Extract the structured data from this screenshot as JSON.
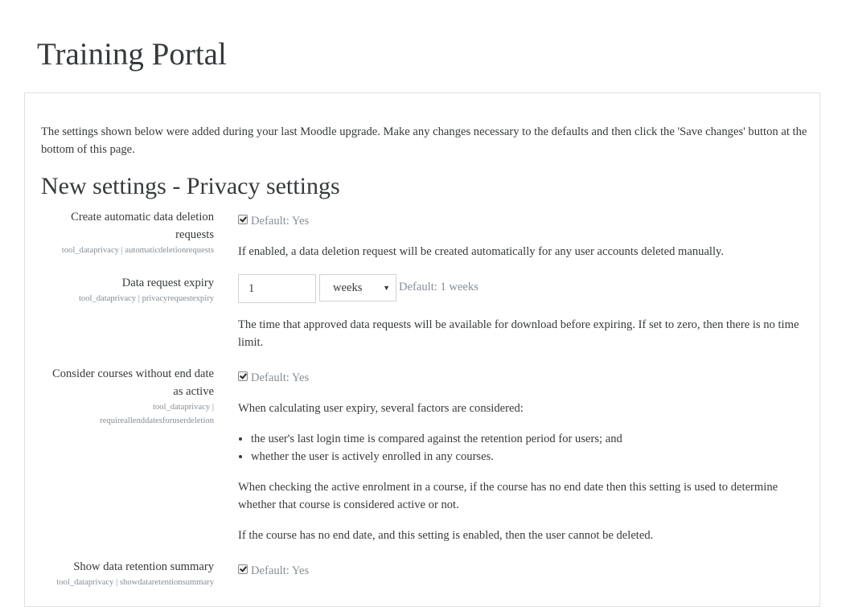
{
  "site": {
    "title": "Training Portal"
  },
  "intro": "The settings shown below were added during your last Moodle upgrade. Make any changes necessary to the defaults and then click the 'Save changes' button at the bottom of this page.",
  "section_heading": "New settings - Privacy settings",
  "settings": [
    {
      "label": "Create automatic data deletion requests",
      "id": "tool_dataprivacy | automaticdeletionrequests",
      "checked": true,
      "default": "Default: Yes",
      "description": "If enabled, a data deletion request will be created automatically for any user accounts deleted manually."
    },
    {
      "label": "Data request expiry",
      "id": "tool_dataprivacy | privacyrequestexpiry",
      "value": "1",
      "unit": "weeks",
      "default": "Default: 1 weeks",
      "description": "The time that approved data requests will be available for download before expiring. If set to zero, then there is no time limit."
    },
    {
      "label": "Consider courses without end date as active",
      "id_part1": "tool_dataprivacy |",
      "id_part2": "requireallenddatesforuserdeletion",
      "checked": true,
      "default": "Default: Yes",
      "intro": "When calculating user expiry, several factors are considered:",
      "bullets": [
        "the user's last login time is compared against the retention period for users; and",
        "whether the user is actively enrolled in any courses."
      ],
      "para2": "When checking the active enrolment in a course, if the course has no end date then this setting is used to determine whether that course is considered active or not.",
      "para3": "If the course has no end date, and this setting is enabled, then the user cannot be deleted."
    },
    {
      "label": "Show data retention summary",
      "id": "tool_dataprivacy | showdataretentionsummary",
      "checked": true,
      "default": "Default: Yes"
    }
  ]
}
